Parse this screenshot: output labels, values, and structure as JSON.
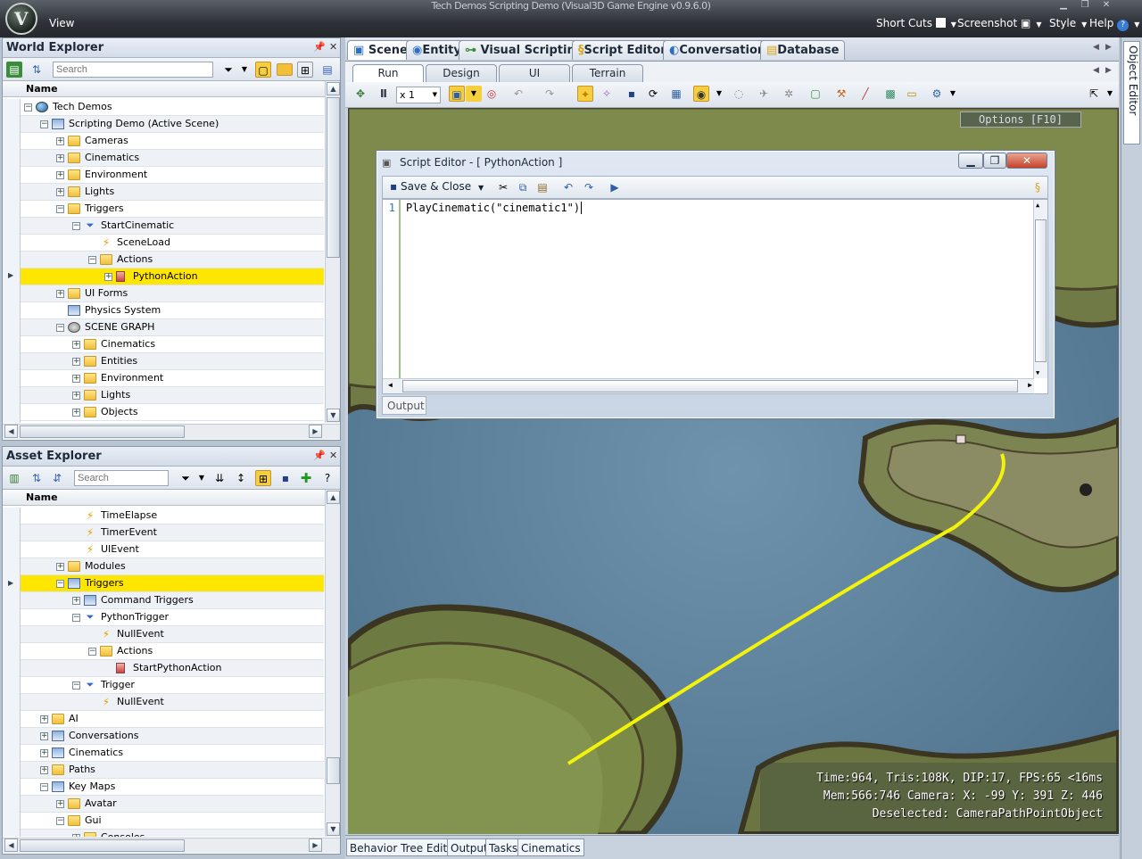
{
  "app": {
    "title": "Tech Demos Scripting Demo (Visual3D Game Engine v0.9.6.0)",
    "menu_view": "View",
    "top_menus": [
      {
        "label": "Short Cuts"
      },
      {
        "label": "Screenshot"
      },
      {
        "label": "Style"
      },
      {
        "label": "Help"
      }
    ],
    "right_rail_label": "Object Editor"
  },
  "world_explorer": {
    "title": "World Explorer",
    "search_placeholder": "Search",
    "column_name": "Name",
    "rows": [
      {
        "label": "Tech Demos",
        "indent": 0,
        "icon": "globe",
        "expander": "minus"
      },
      {
        "label": "Scripting Demo (Active Scene)",
        "indent": 1,
        "icon": "scene",
        "expander": "minus"
      },
      {
        "label": "Cameras",
        "indent": 2,
        "icon": "folder",
        "expander": "plus"
      },
      {
        "label": "Cinematics",
        "indent": 2,
        "icon": "folder",
        "expander": "plus"
      },
      {
        "label": "Environment",
        "indent": 2,
        "icon": "folder",
        "expander": "plus"
      },
      {
        "label": "Lights",
        "indent": 2,
        "icon": "folder",
        "expander": "plus"
      },
      {
        "label": "Triggers",
        "indent": 2,
        "icon": "folder-open",
        "expander": "minus"
      },
      {
        "label": "StartCinematic",
        "indent": 3,
        "icon": "funnel",
        "expander": "minus"
      },
      {
        "label": "SceneLoad",
        "indent": 4,
        "icon": "bolt",
        "expander": "none"
      },
      {
        "label": "Actions",
        "indent": 4,
        "icon": "folder-open",
        "expander": "minus"
      },
      {
        "label": "PythonAction",
        "indent": 5,
        "icon": "python",
        "expander": "plus",
        "selected": true
      },
      {
        "label": "UI Forms",
        "indent": 2,
        "icon": "folder",
        "expander": "plus"
      },
      {
        "label": "Physics System",
        "indent": 2,
        "icon": "scene",
        "expander": "none"
      },
      {
        "label": "SCENE GRAPH",
        "indent": 2,
        "icon": "gear",
        "expander": "minus"
      },
      {
        "label": "Cinematics",
        "indent": 3,
        "icon": "folder",
        "expander": "plus"
      },
      {
        "label": "Entities",
        "indent": 3,
        "icon": "folder",
        "expander": "plus"
      },
      {
        "label": "Environment",
        "indent": 3,
        "icon": "folder",
        "expander": "plus"
      },
      {
        "label": "Lights",
        "indent": 3,
        "icon": "folder",
        "expander": "plus"
      },
      {
        "label": "Objects",
        "indent": 3,
        "icon": "folder",
        "expander": "plus"
      }
    ]
  },
  "asset_explorer": {
    "title": "Asset Explorer",
    "search_placeholder": "Search",
    "column_name": "Name",
    "rows": [
      {
        "label": "TimeElapse",
        "indent": 3,
        "icon": "bolt",
        "expander": "none"
      },
      {
        "label": "TimerEvent",
        "indent": 3,
        "icon": "bolt",
        "expander": "none"
      },
      {
        "label": "UIEvent",
        "indent": 3,
        "icon": "bolt",
        "expander": "none"
      },
      {
        "label": "Modules",
        "indent": 2,
        "icon": "folder",
        "expander": "plus"
      },
      {
        "label": "Triggers",
        "indent": 2,
        "icon": "scene",
        "expander": "minus",
        "selected": true
      },
      {
        "label": "Command Triggers",
        "indent": 3,
        "icon": "scene",
        "expander": "plus"
      },
      {
        "label": "PythonTrigger",
        "indent": 3,
        "icon": "funnel",
        "expander": "minus"
      },
      {
        "label": "NullEvent",
        "indent": 4,
        "icon": "bolt",
        "expander": "none"
      },
      {
        "label": "Actions",
        "indent": 4,
        "icon": "folder-open",
        "expander": "minus"
      },
      {
        "label": "StartPythonAction",
        "indent": 5,
        "icon": "python",
        "expander": "none"
      },
      {
        "label": "Trigger",
        "indent": 3,
        "icon": "funnel",
        "expander": "minus"
      },
      {
        "label": "NullEvent",
        "indent": 4,
        "icon": "bolt",
        "expander": "none"
      },
      {
        "label": "AI",
        "indent": 1,
        "icon": "folder",
        "expander": "plus"
      },
      {
        "label": "Conversations",
        "indent": 1,
        "icon": "scene",
        "expander": "plus"
      },
      {
        "label": "Cinematics",
        "indent": 1,
        "icon": "scene",
        "expander": "plus"
      },
      {
        "label": "Paths",
        "indent": 1,
        "icon": "folder",
        "expander": "plus"
      },
      {
        "label": "Key Maps",
        "indent": 1,
        "icon": "scene",
        "expander": "minus"
      },
      {
        "label": "Avatar",
        "indent": 2,
        "icon": "folder",
        "expander": "plus"
      },
      {
        "label": "Gui",
        "indent": 2,
        "icon": "folder-open",
        "expander": "minus"
      },
      {
        "label": "Consoles",
        "indent": 3,
        "icon": "folder",
        "expander": "plus"
      }
    ]
  },
  "main_tabs": [
    {
      "label": "Scene",
      "active": true
    },
    {
      "label": "Entity"
    },
    {
      "label": "Visual Scripting"
    },
    {
      "label": "Script Editor"
    },
    {
      "label": "Conversation"
    },
    {
      "label": "Database"
    }
  ],
  "sub_tabs": [
    {
      "label": "Run",
      "active": true
    },
    {
      "label": "Design"
    },
    {
      "label": "UI"
    },
    {
      "label": "Terrain"
    }
  ],
  "viewport_toolbar": {
    "speed_value": "x 1"
  },
  "viewport": {
    "options_label": "Options [F10]",
    "stats": [
      "Time:964,  Tris:108K,  DIP:17, FPS:65 <16ms",
      "Mem:566:746  Camera: X: -99 Y: 391 Z: 446",
      "Deselected: CameraPathPointObject"
    ],
    "path_color": "#f2f20a"
  },
  "script_editor": {
    "title": "Script Editor - [ PythonAction ]",
    "save_close_label": "Save & Close",
    "line_number": "1",
    "code": "PlayCinematic(\"cinematic1\")",
    "output_tab": "Output"
  },
  "bottom_tabs": [
    {
      "label": "Behavior Tree Editor"
    },
    {
      "label": "Output"
    },
    {
      "label": "Tasks"
    },
    {
      "label": "Cinematics"
    }
  ]
}
